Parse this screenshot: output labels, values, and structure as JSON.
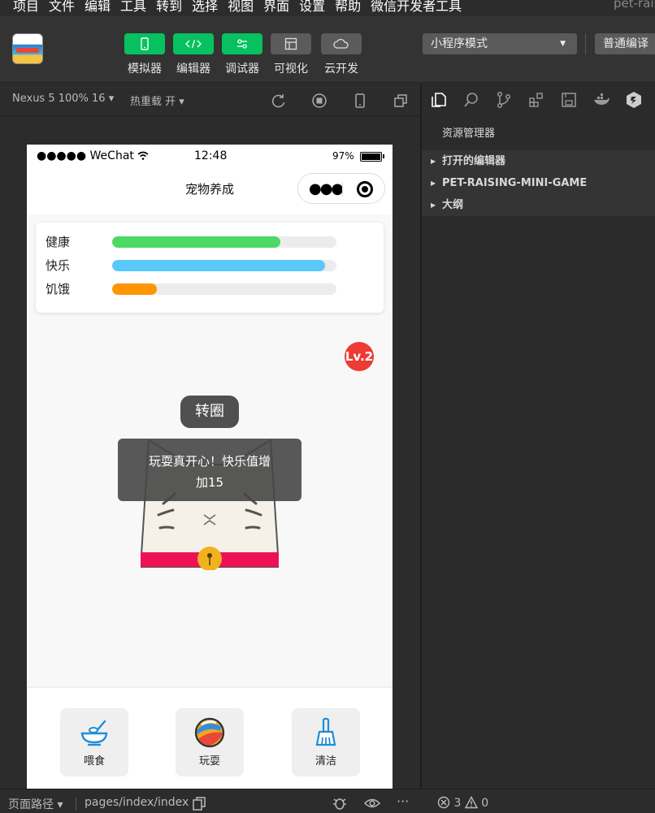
{
  "menubar": {
    "items": [
      "项目",
      "文件",
      "编辑",
      "工具",
      "转到",
      "选择",
      "视图",
      "界面",
      "设置",
      "帮助",
      "微信开发者工具"
    ],
    "project_name": "pet-rais"
  },
  "toolbar": {
    "buttons": [
      {
        "label": "模拟器",
        "icon": "phone-icon"
      },
      {
        "label": "编辑器",
        "icon": "code-icon"
      },
      {
        "label": "调试器",
        "icon": "sliders-icon"
      },
      {
        "label": "可视化",
        "icon": "layout-icon"
      },
      {
        "label": "云开发",
        "icon": "cloud-icon"
      }
    ],
    "mode_select": "小程序模式",
    "compile_select": "普通编译"
  },
  "simulator_header": {
    "device": "Nexus 5 100% 16 ▾",
    "hot_reload": "热重载 开 ▾"
  },
  "explorer": {
    "title": "资源管理器",
    "sections": [
      "打开的编辑器",
      "PET-RAISING-MINI-GAME",
      "大纲"
    ]
  },
  "phone": {
    "status": {
      "signal": "●●●●● WeChat",
      "time": "12:48",
      "battery": "97%"
    },
    "nav_title": "宠物养成",
    "stats": [
      {
        "label": "健康",
        "value": 0.75,
        "color": "#4cd964"
      },
      {
        "label": "快乐",
        "value": 0.95,
        "color": "#5ac8fa"
      },
      {
        "label": "饥饿",
        "value": 0.2,
        "color": "#ff9500"
      }
    ],
    "level_badge": "Lv.2",
    "action_bubble": "转圈",
    "toast": {
      "line1": "玩耍真开心！快乐值增",
      "line2": "加15"
    },
    "actions": [
      {
        "label": "喂食",
        "icon": "bowl-icon"
      },
      {
        "label": "玩耍",
        "icon": "ball-icon"
      },
      {
        "label": "清洁",
        "icon": "broom-icon"
      }
    ]
  },
  "bottom_status": {
    "page_path_label": "页面路径 ▾",
    "page_path": "pages/index/index",
    "errors": "3",
    "warnings": "0"
  }
}
